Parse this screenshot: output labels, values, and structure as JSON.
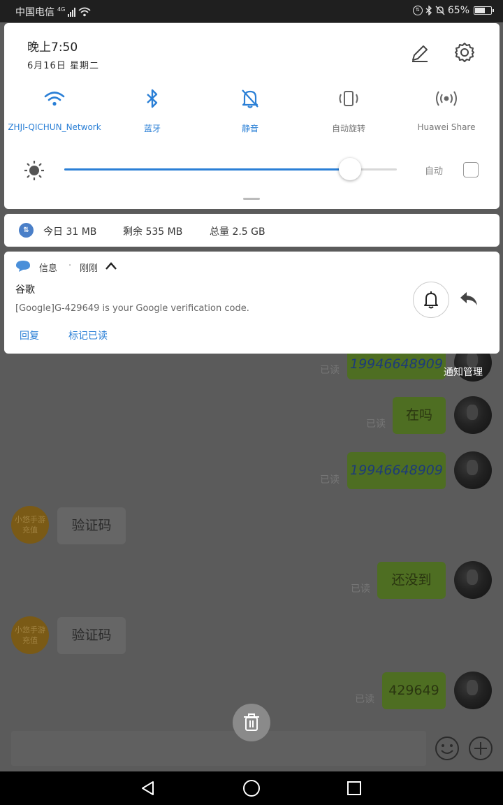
{
  "status_bar": {
    "carrier": "中国电信",
    "network": "4G",
    "battery": "65%",
    "battery_level": 0.65
  },
  "quick_settings": {
    "time": "晚上7:50",
    "date": "6月16日 星期二",
    "tiles": [
      {
        "label": "ZHJI-QICHUN_Network",
        "icon": "wifi-icon",
        "active": true
      },
      {
        "label": "蓝牙",
        "icon": "bluetooth-icon",
        "active": true
      },
      {
        "label": "静音",
        "icon": "bell-off-icon",
        "active": true
      },
      {
        "label": "自动旋转",
        "icon": "auto-rotate-icon",
        "active": false
      },
      {
        "label": "Huawei Share",
        "icon": "huawei-share-icon",
        "active": false
      }
    ],
    "brightness_level": 0.86,
    "auto_brightness_label": "自动"
  },
  "data_usage": {
    "today": "今日 31 MB",
    "remaining": "剩余 535 MB",
    "total": "总量 2.5 GB"
  },
  "notification": {
    "app": "信息",
    "separator": "·",
    "time": "刚刚",
    "title": "谷歌",
    "body": "[Google]G-429649 is your Google verification code.",
    "actions": [
      "回复",
      "标记已读"
    ]
  },
  "chat": {
    "manage_label": "通知管理",
    "read_label": "已读",
    "messages": [
      {
        "dir": "out",
        "text": "19946648909"
      },
      {
        "dir": "out",
        "text": "在吗"
      },
      {
        "dir": "out",
        "text": "19946648909"
      },
      {
        "dir": "in",
        "text": "验证码",
        "avatar": "小悠手游充值"
      },
      {
        "dir": "out",
        "text": "还没到"
      },
      {
        "dir": "in",
        "text": "验证码",
        "avatar": "小悠手游充值"
      },
      {
        "dir": "out",
        "text": "429649"
      }
    ]
  },
  "colors": {
    "accent": "#2a7fd6",
    "outgoing_bubble": "#4e6e22",
    "scrim": "#5b5b5b"
  }
}
